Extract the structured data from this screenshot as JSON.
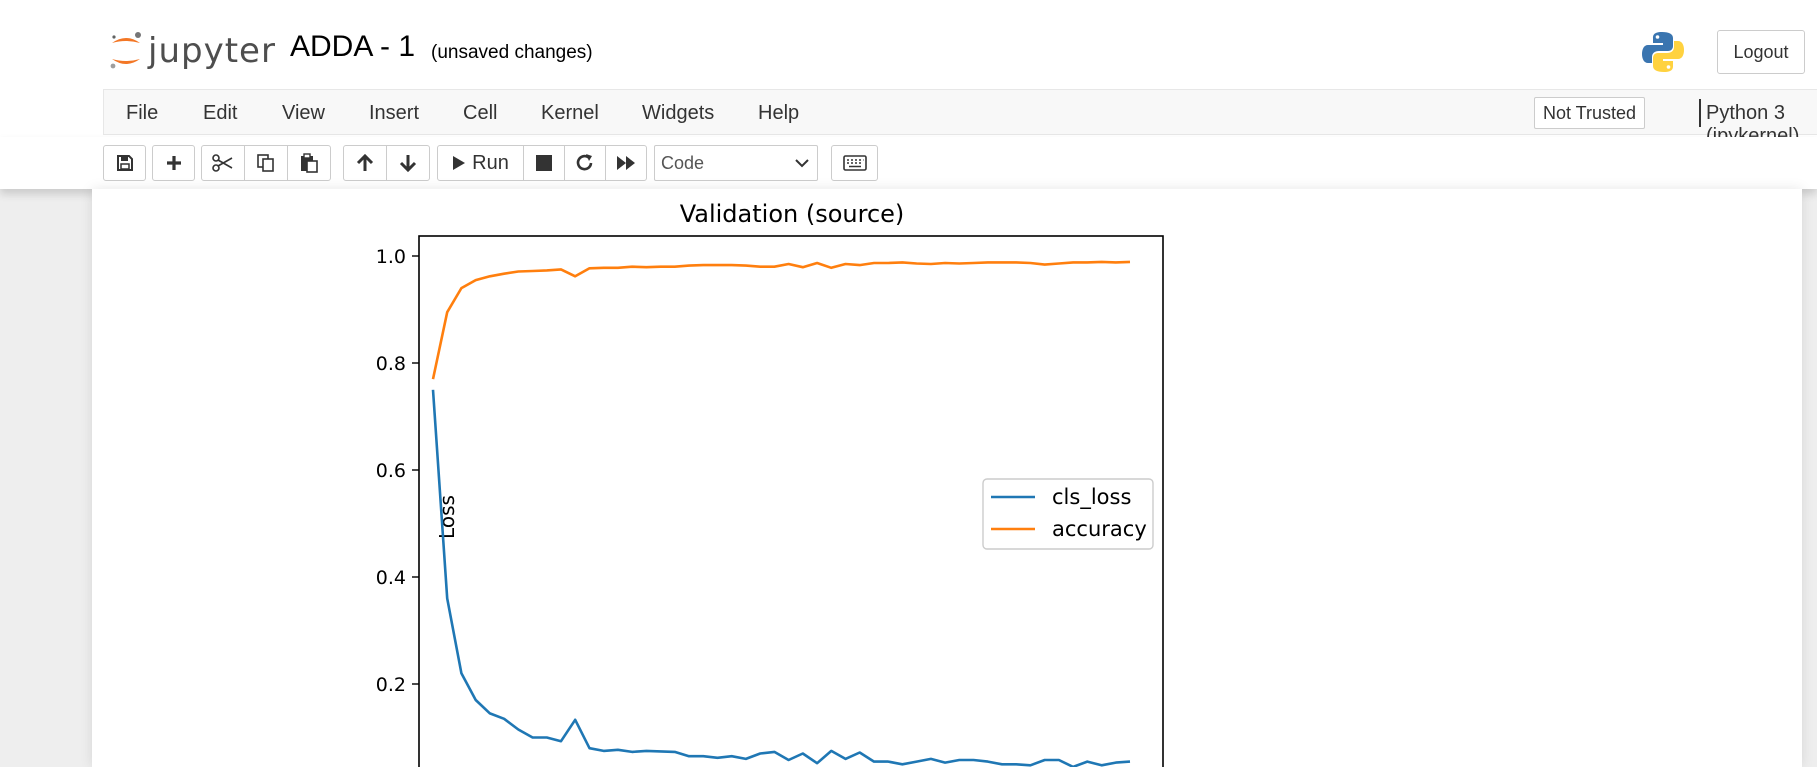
{
  "header": {
    "logo_text": "jupyter",
    "notebook_name": "ADDA - 1",
    "save_status": "(unsaved changes)",
    "logout_label": "Logout"
  },
  "menubar": {
    "items": [
      "File",
      "Edit",
      "View",
      "Insert",
      "Cell",
      "Kernel",
      "Widgets",
      "Help"
    ],
    "trust_label": "Not Trusted",
    "kernel_name": "Python 3 (ipykernel)"
  },
  "toolbar": {
    "buttons": [
      "save-icon",
      "plus-icon",
      "scissors-icon",
      "copy-icon",
      "paste-icon",
      "arrow-up-icon",
      "arrow-down-icon",
      "run",
      "stop-icon",
      "restart-icon",
      "fast-forward-icon",
      "keyboard-icon"
    ],
    "run_label": "Run",
    "cell_type": "Code"
  },
  "colors": {
    "jupyter_orange": "#f37726",
    "series_cls_loss": "#1f77b4",
    "series_accuracy": "#ff7f0e"
  },
  "chart_data": {
    "type": "line",
    "title": "Validation (source)",
    "ylabel": "Loss",
    "xlabel": "",
    "ylim": [
      0.0,
      1.02
    ],
    "yticks": [
      "1.0",
      "0.8",
      "0.6",
      "0.4",
      "0.2"
    ],
    "grid": false,
    "legend_position": "center-right",
    "x": [
      0,
      1,
      2,
      3,
      4,
      5,
      6,
      7,
      8,
      9,
      10,
      11,
      12,
      13,
      14,
      15,
      16,
      17,
      18,
      19,
      20,
      21,
      22,
      23,
      24,
      25,
      26,
      27,
      28,
      29,
      30,
      31,
      32,
      33,
      34,
      35,
      36,
      37,
      38,
      39,
      40,
      41,
      42,
      43,
      44,
      45,
      46,
      47,
      48,
      49
    ],
    "series": [
      {
        "name": "cls_loss",
        "values": [
          0.75,
          0.36,
          0.22,
          0.17,
          0.145,
          0.135,
          0.115,
          0.1,
          0.1,
          0.093,
          0.133,
          0.08,
          0.075,
          0.077,
          0.073,
          0.075,
          0.074,
          0.073,
          0.065,
          0.065,
          0.062,
          0.065,
          0.06,
          0.07,
          0.073,
          0.058,
          0.07,
          0.052,
          0.075,
          0.06,
          0.072,
          0.055,
          0.055,
          0.05,
          0.055,
          0.06,
          0.053,
          0.058,
          0.058,
          0.055,
          0.05,
          0.05,
          0.048,
          0.058,
          0.058,
          0.045,
          0.055,
          0.048,
          0.053,
          0.055
        ]
      },
      {
        "name": "accuracy",
        "values": [
          0.77,
          0.895,
          0.94,
          0.955,
          0.962,
          0.967,
          0.971,
          0.972,
          0.973,
          0.975,
          0.962,
          0.977,
          0.978,
          0.978,
          0.98,
          0.979,
          0.98,
          0.98,
          0.982,
          0.983,
          0.983,
          0.983,
          0.982,
          0.98,
          0.98,
          0.985,
          0.979,
          0.987,
          0.978,
          0.985,
          0.983,
          0.987,
          0.987,
          0.988,
          0.986,
          0.985,
          0.987,
          0.986,
          0.987,
          0.988,
          0.988,
          0.988,
          0.987,
          0.984,
          0.986,
          0.988,
          0.988,
          0.989,
          0.988,
          0.989
        ]
      }
    ]
  }
}
